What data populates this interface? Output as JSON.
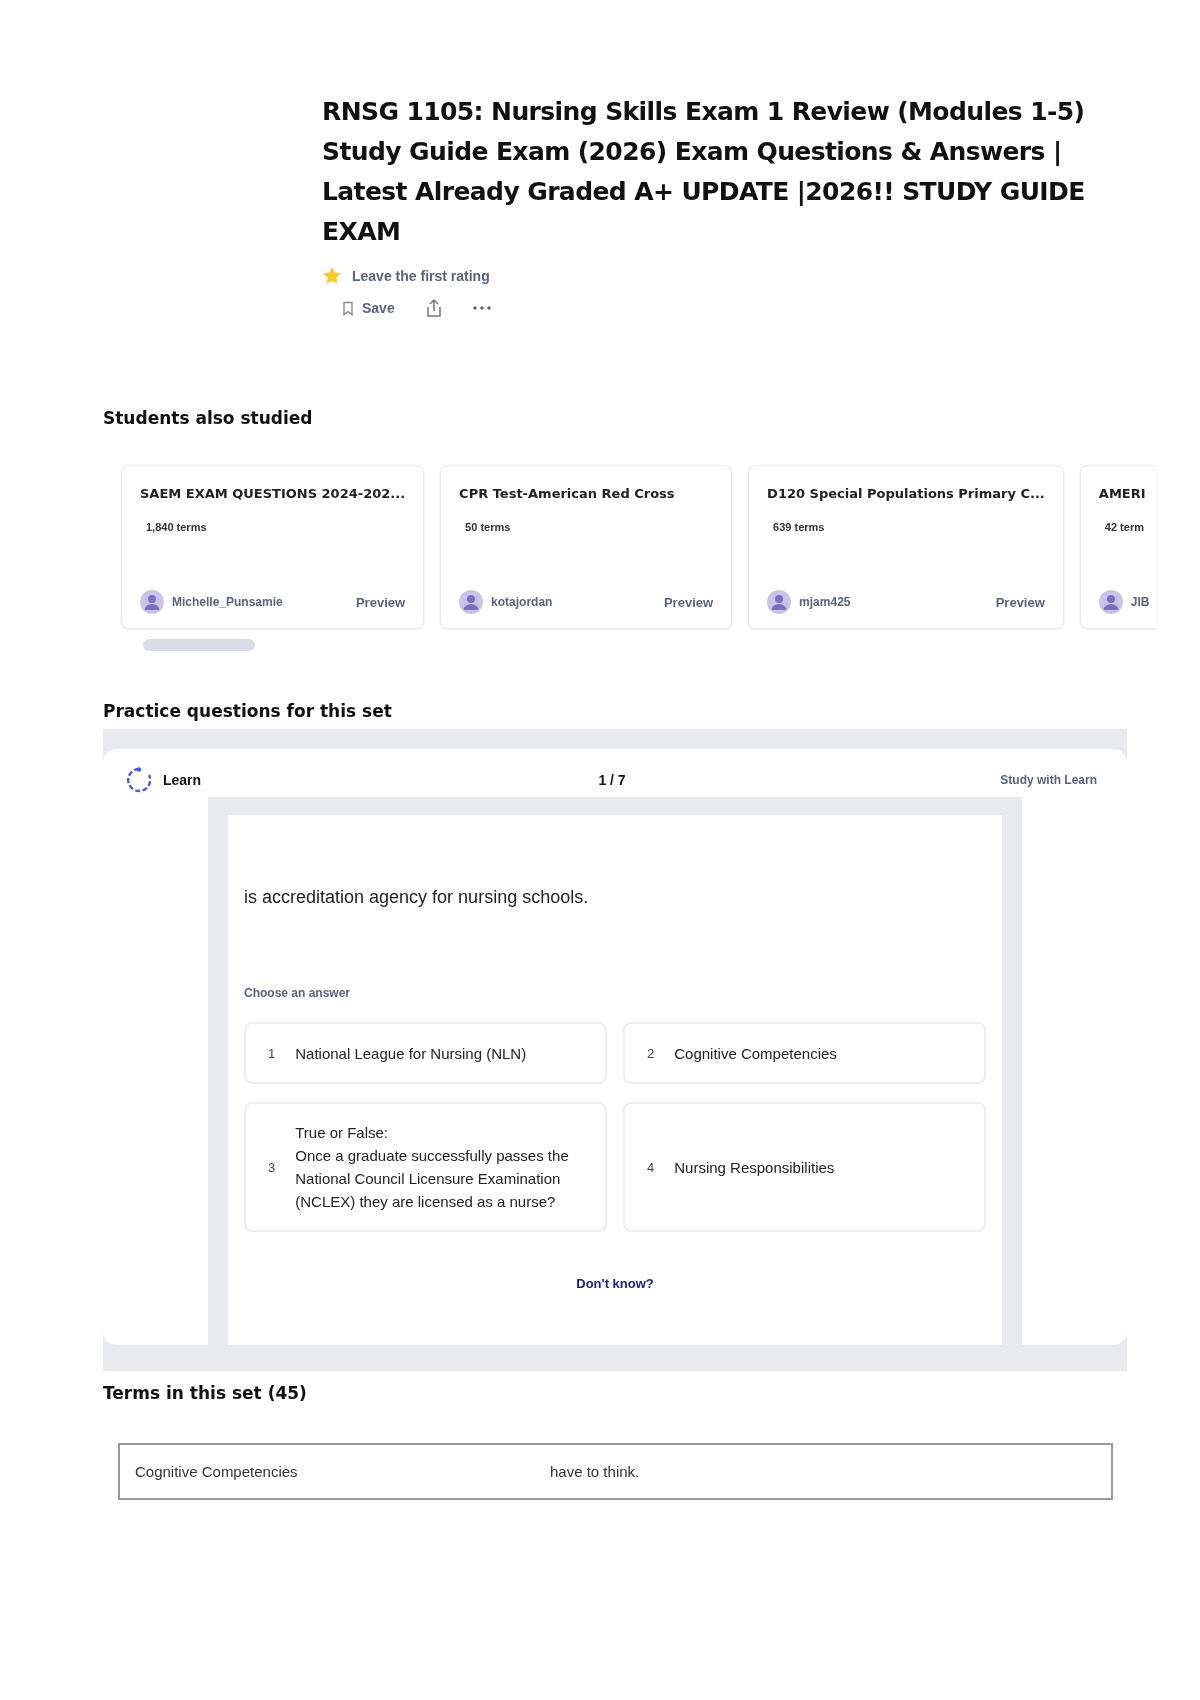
{
  "title": "RNSG 1105: Nursing Skills Exam 1 Review (Modules 1-5) Study Guide Exam (2026) Exam Questions & Answers | Latest Already Graded A+ UPDATE |2026!! STUDY GUIDE EXAM",
  "rating": {
    "label": "Leave the first rating"
  },
  "actions": {
    "save": "Save"
  },
  "also_studied": {
    "heading": "Students also studied",
    "cards": [
      {
        "title": "SAEM EXAM QUESTIONS 2024-202...",
        "terms": "1,840 terms",
        "author": "Michelle_Punsamie",
        "preview": "Preview"
      },
      {
        "title": "CPR Test-American Red Cross",
        "terms": "50 terms",
        "author": "kotajordan",
        "preview": "Preview"
      },
      {
        "title": "D120 Special Populations Primary C...",
        "terms": "639 terms",
        "author": "mjam425",
        "preview": "Preview"
      },
      {
        "title": "AMERI",
        "terms": "42 term",
        "author": "JIB"
      }
    ]
  },
  "practice": {
    "heading": "Practice questions for this set",
    "mode": "Learn",
    "progress": "1 / 7",
    "study_link": "Study with Learn",
    "question": "is accreditation agency for nursing schools.",
    "prompt": "Choose an answer",
    "options": [
      {
        "number": "1",
        "text": "National League for Nursing (NLN)"
      },
      {
        "number": "2",
        "text": "Cognitive Competencies"
      },
      {
        "number": "3",
        "text": "True or False:\nOnce a graduate successfully passes the National Council Licensure Examination (NCLEX) they are licensed as a nurse?"
      },
      {
        "number": "4",
        "text": "Nursing Responsibilities"
      }
    ],
    "dont_know": "Don't know?"
  },
  "terms": {
    "heading": "Terms in this set (45)",
    "rows": [
      {
        "term": "Cognitive Competencies",
        "definition": "have to think."
      }
    ]
  }
}
